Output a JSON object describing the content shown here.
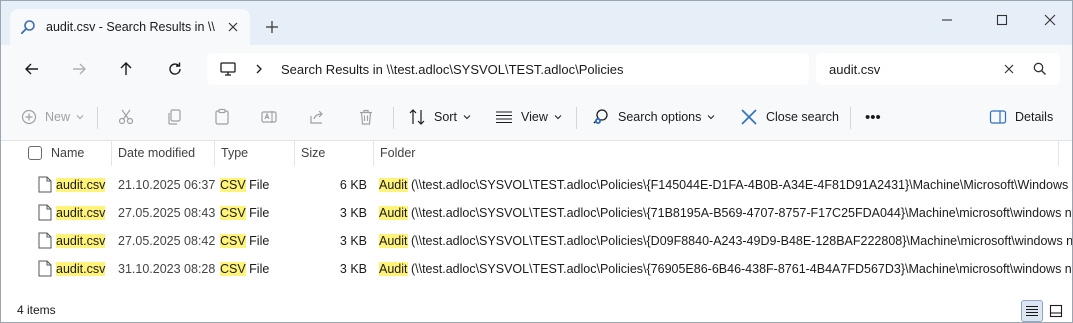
{
  "tab": {
    "title": "audit.csv - Search Results in \\\\",
    "icon": "search-icon"
  },
  "window_controls": [
    "minimize",
    "maximize",
    "close"
  ],
  "address": {
    "path": "Search Results in \\\\test.adloc\\SYSVOL\\TEST.adloc\\Policies"
  },
  "search": {
    "value": "audit.csv"
  },
  "toolbar": {
    "new_label": "New",
    "sort_label": "Sort",
    "view_label": "View",
    "search_options_label": "Search options",
    "close_search_label": "Close search",
    "more_label": "•••",
    "details_label": "Details"
  },
  "columns": {
    "name": "Name",
    "date": "Date modified",
    "type": "Type",
    "size": "Size",
    "folder": "Folder"
  },
  "rows": [
    {
      "name": "audit.csv",
      "date": "21.10.2025 06:37",
      "type_hl": "CSV",
      "type_rest": " File",
      "size": "6 KB",
      "folder_hl": "Audit",
      "folder_rest": " (\\\\test.adloc\\SYSVOL\\TEST.adloc\\Policies\\{F145044E-D1FA-4B0B-A34E-4F81D91A2431}\\Machine\\Microsoft\\Windows NT)"
    },
    {
      "name": "audit.csv",
      "date": "27.05.2025 08:43",
      "type_hl": "CSV",
      "type_rest": " File",
      "size": "3 KB",
      "folder_hl": "Audit",
      "folder_rest": " (\\\\test.adloc\\SYSVOL\\TEST.adloc\\Policies\\{71B8195A-B569-4707-8757-F17C25FDA044}\\Machine\\microsoft\\windows nt)"
    },
    {
      "name": "audit.csv",
      "date": "27.05.2025 08:42",
      "type_hl": "CSV",
      "type_rest": " File",
      "size": "3 KB",
      "folder_hl": "Audit",
      "folder_rest": " (\\\\test.adloc\\SYSVOL\\TEST.adloc\\Policies\\{D09F8840-A243-49D9-B48E-128BAF222808}\\Machine\\microsoft\\windows nt)"
    },
    {
      "name": "audit.csv",
      "date": "31.10.2023 08:28",
      "type_hl": "CSV",
      "type_rest": " File",
      "size": "3 KB",
      "folder_hl": "Audit",
      "folder_rest": " (\\\\test.adloc\\SYSVOL\\TEST.adloc\\Policies\\{76905E86-6B46-438F-8761-4B4A7FD567D3}\\Machine\\microsoft\\windows nt)"
    }
  ],
  "status": {
    "count": "4 items"
  },
  "colors": {
    "highlight": "#fff37a",
    "accent": "#1a5fb4",
    "titlebar": "#e6eef7"
  }
}
